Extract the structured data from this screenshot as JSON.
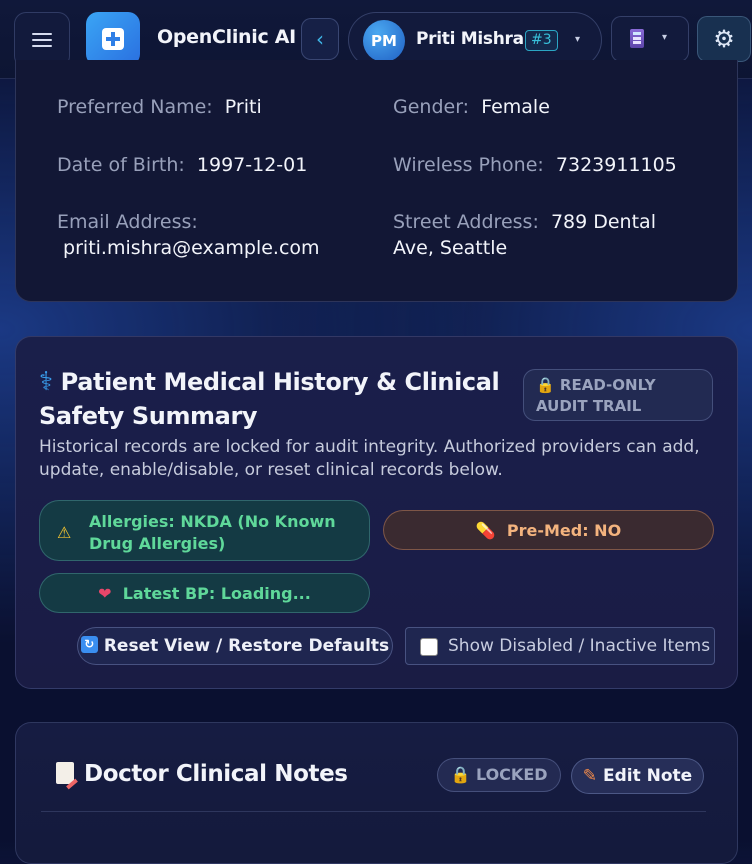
{
  "header": {
    "app_title": "OpenClinic AI",
    "back_glyph": "‹",
    "patient": {
      "initials": "PM",
      "name": "Priti Mishra",
      "number": "#3"
    },
    "caret": "▾",
    "settings_glyph": "⚙"
  },
  "demographics": {
    "preferred_name": {
      "label": "Preferred Name:",
      "value": "Priti"
    },
    "gender": {
      "label": "Gender:",
      "value": "Female"
    },
    "dob": {
      "label": "Date of Birth:",
      "value": "1997-12-01"
    },
    "wireless_phone": {
      "label": "Wireless Phone:",
      "value": "7323911105"
    },
    "email": {
      "label": "Email Address:",
      "value": "priti.mishra@example.com"
    },
    "street_address": {
      "label": "Street Address:",
      "value": "789 Dental Ave, Seattle"
    }
  },
  "history": {
    "icon_glyph": "⚕",
    "title": "Patient Medical History & Clinical Safety Summary",
    "badge_icon": "🔒",
    "badge": "READ-ONLY AUDIT TRAIL",
    "description": "Historical records are locked for audit integrity. Authorized providers can add, update, enable/disable, or reset clinical records below.",
    "warn_glyph": "⚠",
    "allergies": "Allergies: NKDA (No Known Drug Allergies)",
    "premed_glyph": "💊",
    "premed": "Pre-Med: NO",
    "heart_glyph": "❤",
    "bp": "Latest BP: Loading...",
    "reset_glyph": "🔄",
    "reset_label": "Reset View / Restore Defaults",
    "show_disabled_label": "Show Disabled / Inactive Items"
  },
  "notes": {
    "title": "Doctor Clinical Notes",
    "locked_icon": "🔒",
    "locked": "LOCKED",
    "edit_icon": "✎",
    "edit_label": "Edit Note"
  }
}
